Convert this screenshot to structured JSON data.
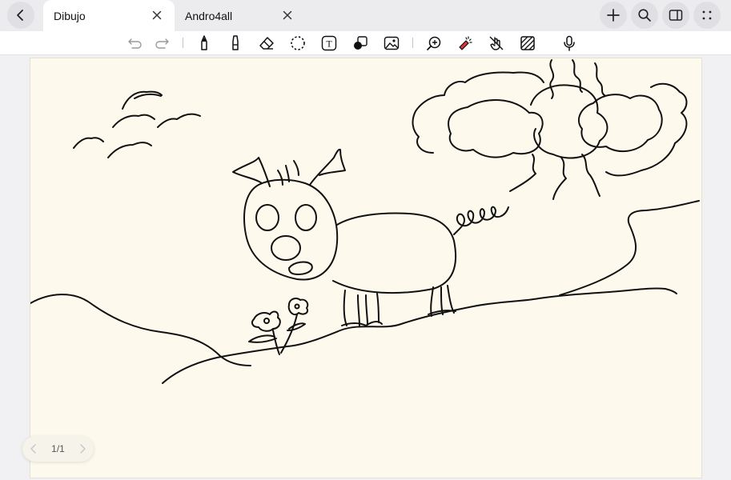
{
  "tabs": [
    {
      "label": "Dibujo",
      "active": true
    },
    {
      "label": "Andro4all",
      "active": false
    }
  ],
  "window_buttons": {
    "back": "chevron-left-icon",
    "new_tab": "plus-icon",
    "search": "search-icon",
    "sidebar": "sidebar-panel-icon",
    "more": "dots-grid-icon"
  },
  "toolbar": {
    "tools": [
      "undo-icon",
      "redo-icon",
      "pen-icon",
      "highlighter-icon",
      "eraser-icon",
      "lasso-icon",
      "text-icon",
      "shapes-icon",
      "image-icon",
      "zoom-icon",
      "laser-pointer-icon",
      "touch-draw-icon",
      "texture-icon",
      "microphone-icon"
    ],
    "text_tool_glyph": "T"
  },
  "pager": {
    "label": "1/1"
  },
  "colors": {
    "canvas": "#fdf9ec",
    "ink": "#111111",
    "tab_bar": "#ececef"
  }
}
